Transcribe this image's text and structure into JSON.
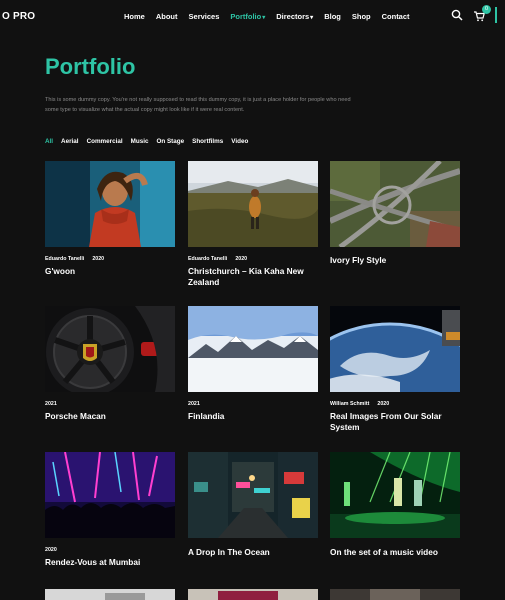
{
  "brand": {
    "logo_text": "O PRO"
  },
  "nav": {
    "items": [
      {
        "label": "Home"
      },
      {
        "label": "About"
      },
      {
        "label": "Services"
      },
      {
        "label": "Portfolio"
      },
      {
        "label": "Directors"
      },
      {
        "label": "Blog"
      },
      {
        "label": "Shop"
      },
      {
        "label": "Contact"
      }
    ],
    "cart_count": "0"
  },
  "page": {
    "title": "Portfolio",
    "intro": "This is some dummy copy. You're not really supposed to read this dummy copy, it is just a place holder for people who need some type to visualize what the actual copy might look like if it were real content."
  },
  "filters": [
    "All",
    "Aerial",
    "Commercial",
    "Music",
    "On Stage",
    "Shortfilms",
    "Video"
  ],
  "portfolio": [
    {
      "title": "G'woon",
      "author": "Eduardo Tanelli",
      "year": "2020"
    },
    {
      "title": "Christchurch – Kia Kaha New Zealand",
      "author": "Eduardo Tanelli",
      "year": "2020"
    },
    {
      "title": "Ivory Fly Style",
      "author": "",
      "year": ""
    },
    {
      "title": "Porsche Macan",
      "author": "",
      "year": "2021"
    },
    {
      "title": "Finlandia",
      "author": "",
      "year": "2021"
    },
    {
      "title": "Real Images From Our Solar System",
      "author": "William Schmitt",
      "year": "2020"
    },
    {
      "title": "Rendez-Vous at Mumbai",
      "author": "",
      "year": "2020"
    },
    {
      "title": "A Drop In The Ocean",
      "author": "",
      "year": ""
    },
    {
      "title": "On the set of a music video",
      "author": "",
      "year": ""
    }
  ],
  "colors": {
    "accent": "#2ec4a5",
    "background": "#111111"
  }
}
